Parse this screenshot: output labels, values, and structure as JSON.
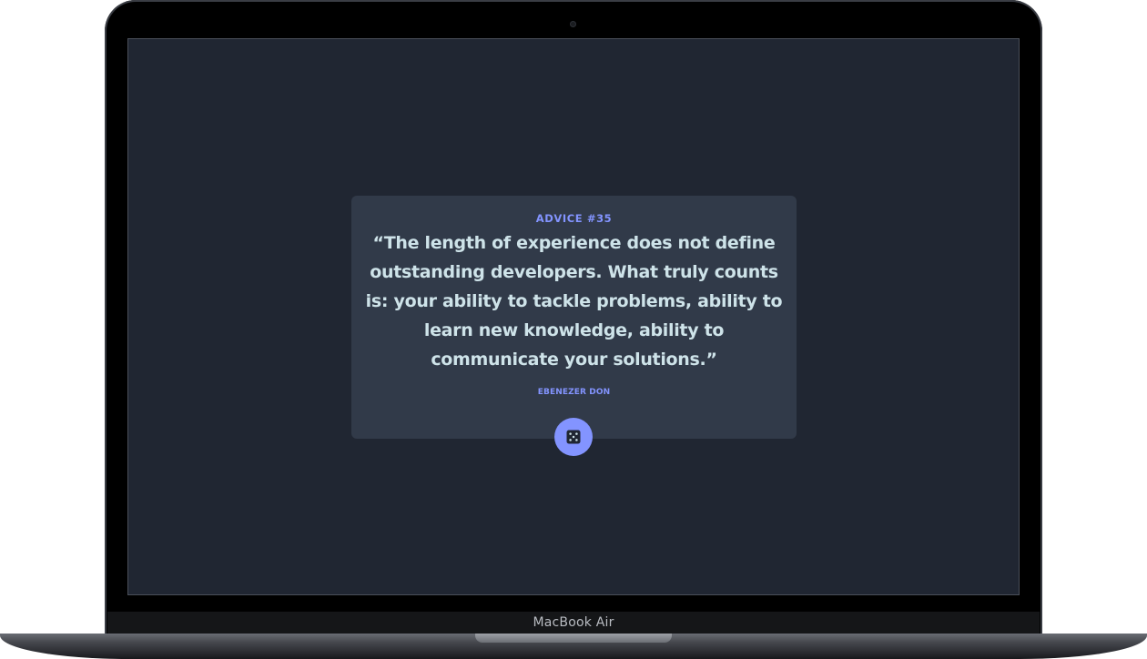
{
  "device": {
    "brand_label": "MacBook Air"
  },
  "advice_card": {
    "advice_id": "ADVICE #35",
    "quote": "“The length of experience does not define outstanding developers. What truly counts is: your ability to tackle problems, ability to learn new knowledge, ability to communicate your solutions.”",
    "author": "EBENEZER DON",
    "generate_button_icon": "dice-icon"
  },
  "colors": {
    "screen_background": "#202632",
    "card_background": "#313a49",
    "accent": "#8394ff",
    "quote_text": "#cee3e9"
  }
}
